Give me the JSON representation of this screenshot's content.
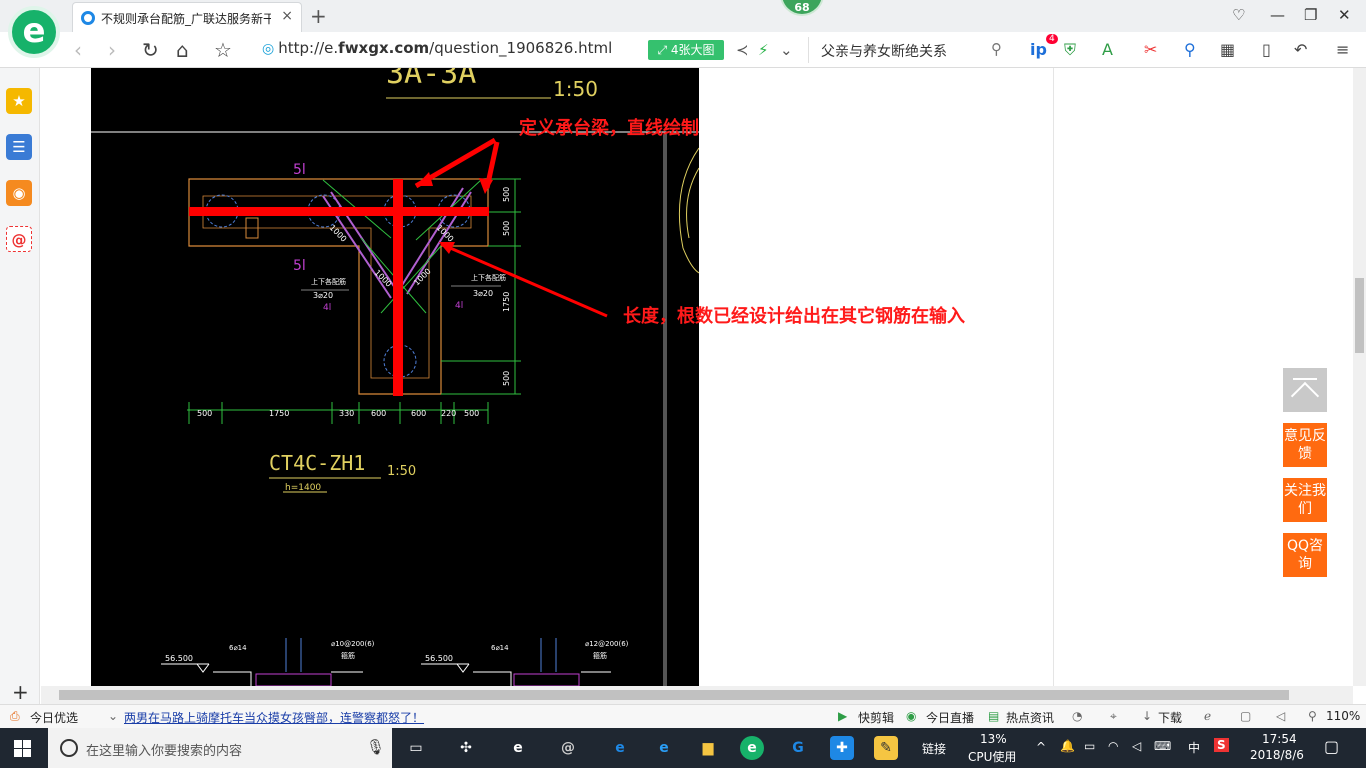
{
  "browser": {
    "tab_title": "不规则承台配筋_广联达服务新干线",
    "tab_close": "×",
    "new_tab": "+",
    "badge": "68",
    "url_prefix": "http://e.",
    "url_domain": "fwxgx.com",
    "url_path": "/question_1906826.html",
    "big_image_button": "4张大图",
    "search_text": "父亲与养女断绝关系",
    "ext_badge": "4"
  },
  "page": {
    "cad": {
      "section_label": "3A-3A",
      "section_scale": "1:50",
      "mark_left": "5l",
      "mark_left2": "5l",
      "rebar_left_title": "上下各配筋",
      "rebar_left_value": "3⌀20",
      "rebar_left_tag": "4l",
      "rebar_right_title": "上下各配筋",
      "rebar_right_value": "3⌀20",
      "rebar_right_tag": "4l",
      "diag_1": "1000",
      "diag_2": "1000",
      "diag_3": "1000",
      "diag_4": "1000",
      "dim_bottom": [
        "500",
        "1750",
        "330",
        "600",
        "600",
        "220",
        "500"
      ],
      "dim_right": [
        "500",
        "500",
        "1750",
        "500"
      ],
      "drawing_name": "CT4C-ZH1",
      "drawing_scale": "1:50",
      "height_note": "h=1400",
      "elev_left": "56.500",
      "elev_right": "56.500",
      "bar_left": "6⌀14",
      "bar_right": "6⌀14",
      "stirrup_left": "⌀10@200(6)",
      "stirrup_left2": "箍筋",
      "stirrup_right": "⌀12@200(6)",
      "stirrup_right2": "箍筋"
    },
    "annotation_top": "定义承台梁，直线绘制",
    "annotation_right": "长度，根数已经设计给出在其它钢筋在输入",
    "float_feedback": "意见反馈",
    "float_follow": "关注我们",
    "float_qq": "QQ咨询"
  },
  "statusbar": {
    "today_pick": "今日优选",
    "news": "两男在马路上骑摩托车当众摸女孩臀部，连警察都怒了！",
    "quick_cut": "快剪辑",
    "live": "今日直播",
    "hot_news": "热点资讯",
    "download": "下载",
    "zoom": "110%"
  },
  "taskbar": {
    "search_placeholder": "在这里输入你要搜索的内容",
    "link_label": "链接",
    "cpu_percent": "13%",
    "cpu_label": "CPU使用",
    "ime": "中",
    "time": "17:54",
    "date": "2018/8/6"
  }
}
